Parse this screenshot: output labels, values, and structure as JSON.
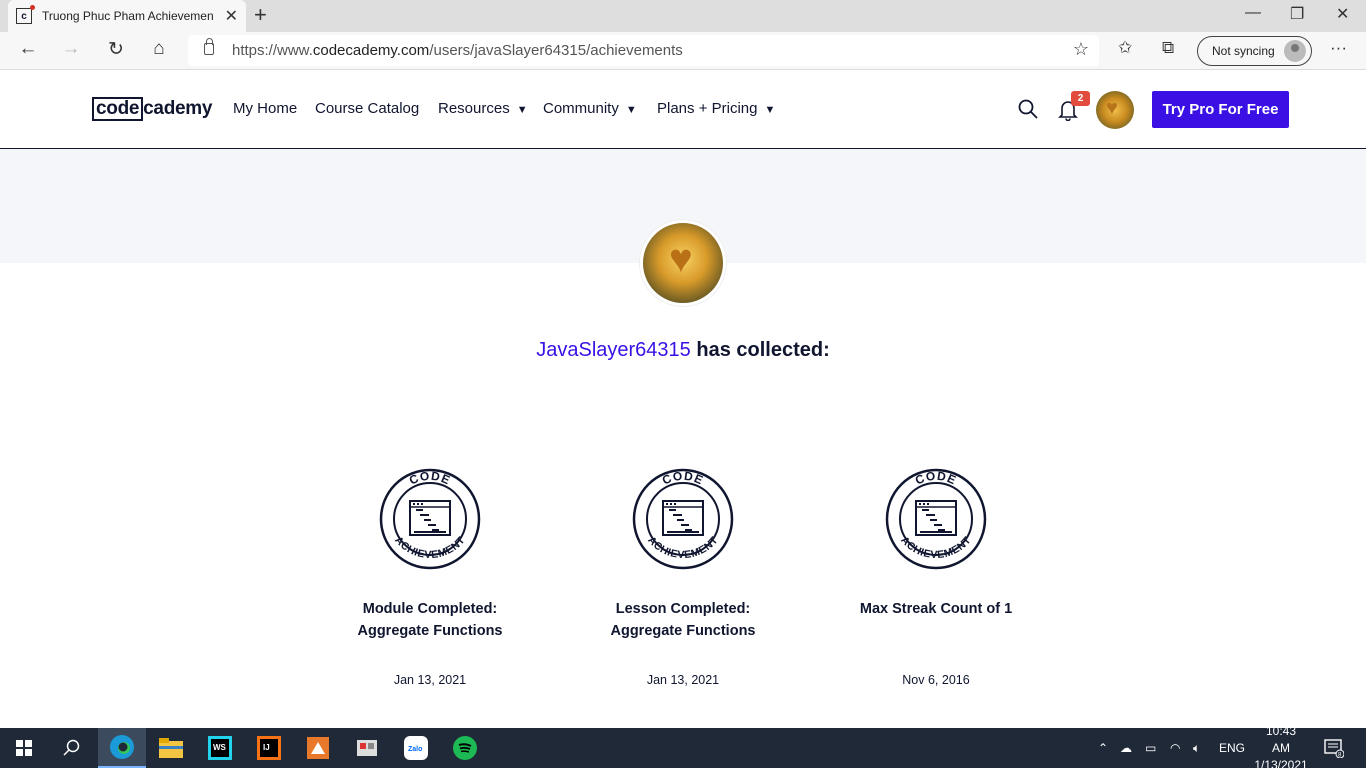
{
  "browser": {
    "tab_title": "Truong Phuc Pham Achievements",
    "url_prefix": "https://www.",
    "url_domain": "codecademy.com",
    "url_path": "/users/javaSlayer64315/achievements",
    "sync_label": "Not syncing"
  },
  "site": {
    "logo_box": "code",
    "logo_rest": "cademy",
    "nav": [
      {
        "label": "My Home"
      },
      {
        "label": "Course Catalog"
      },
      {
        "label": "Resources"
      },
      {
        "label": "Community"
      },
      {
        "label": "Plans + Pricing"
      }
    ],
    "notification_count": "2",
    "cta_label": "Try Pro For Free"
  },
  "profile": {
    "username": "JavaSlayer64315",
    "collected_suffix": " has collected:"
  },
  "achievements": [
    {
      "title_line1": "Module Completed:",
      "title_line2": "Aggregate Functions",
      "date": "Jan 13, 2021",
      "badge_top": "CODE",
      "badge_bottom": "ACHIEVEMENT"
    },
    {
      "title_line1": "Lesson Completed:",
      "title_line2": "Aggregate Functions",
      "date": "Jan 13, 2021",
      "badge_top": "CODE",
      "badge_bottom": "ACHIEVEMENT"
    },
    {
      "title_line1": "Max Streak Count of 1",
      "title_line2": "",
      "date": "Nov 6, 2016",
      "badge_top": "CODE",
      "badge_bottom": "ACHIEVEMENT"
    }
  ],
  "taskbar": {
    "language": "ENG",
    "time": "10:43 AM",
    "date": "1/13/2021",
    "notification_count": "8"
  },
  "colors": {
    "brand": "#3a10e5",
    "navy": "#10162f",
    "badge_red": "#e24c3e"
  }
}
